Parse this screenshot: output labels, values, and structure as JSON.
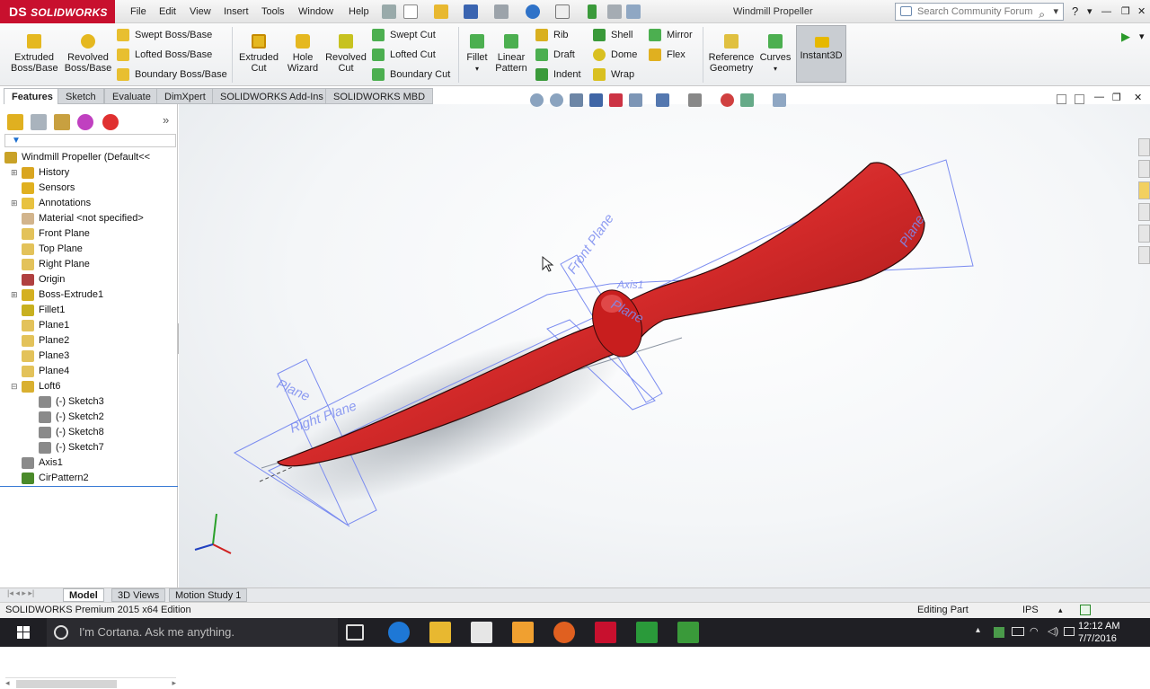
{
  "app": {
    "brand": "SOLIDWORKS",
    "brand_mark": "DS",
    "window_title": "Windmill Propeller"
  },
  "menu": [
    "File",
    "Edit",
    "View",
    "Insert",
    "Tools",
    "Window",
    "Help"
  ],
  "search": {
    "placeholder": "Search Community Forum"
  },
  "ribbon": {
    "extruded_boss": [
      "Extruded",
      "Boss/Base"
    ],
    "revolved_boss": [
      "Revolved",
      "Boss/Base"
    ],
    "swept_boss": "Swept Boss/Base",
    "lofted_boss": "Lofted Boss/Base",
    "boundary_boss": "Boundary Boss/Base",
    "extruded_cut": [
      "Extruded",
      "Cut"
    ],
    "hole_wizard": [
      "Hole",
      "Wizard"
    ],
    "revolved_cut": [
      "Revolved",
      "Cut"
    ],
    "swept_cut": "Swept Cut",
    "lofted_cut": "Lofted Cut",
    "boundary_cut": "Boundary Cut",
    "fillet": "Fillet",
    "linear_pattern": [
      "Linear",
      "Pattern"
    ],
    "rib": "Rib",
    "draft": "Draft",
    "indent": "Indent",
    "shell": "Shell",
    "dome": "Dome",
    "wrap": "Wrap",
    "mirror": "Mirror",
    "flex": "Flex",
    "reference_geometry": [
      "Reference",
      "Geometry"
    ],
    "curves": "Curves",
    "instant3d": "Instant3D"
  },
  "command_tabs": [
    "Features",
    "Sketch",
    "Evaluate",
    "DimXpert",
    "SOLIDWORKS Add-Ins",
    "SOLIDWORKS MBD"
  ],
  "tree": [
    {
      "label": "Windmill Propeller  (Default<<",
      "icon": "part-icon",
      "color": "#c9a227"
    },
    {
      "label": "History",
      "icon": "history-icon",
      "color": "#d9a520"
    },
    {
      "label": "Sensors",
      "icon": "sensors-icon",
      "color": "#e0b020"
    },
    {
      "label": "Annotations",
      "icon": "annotations-icon",
      "color": "#e8c240"
    },
    {
      "label": "Material <not specified>",
      "icon": "material-icon",
      "color": "#d2b48c"
    },
    {
      "label": "Front Plane",
      "icon": "plane-icon",
      "color": "#e3c25a"
    },
    {
      "label": "Top Plane",
      "icon": "plane-icon",
      "color": "#e3c25a"
    },
    {
      "label": "Right Plane",
      "icon": "plane-icon",
      "color": "#e3c25a"
    },
    {
      "label": "Origin",
      "icon": "origin-icon",
      "color": "#b04040"
    },
    {
      "label": "Boss-Extrude1",
      "icon": "extrude-icon",
      "color": "#d4b020"
    },
    {
      "label": "Fillet1",
      "icon": "fillet-icon",
      "color": "#c8b020"
    },
    {
      "label": "Plane1",
      "icon": "plane-icon",
      "color": "#e3c25a"
    },
    {
      "label": "Plane2",
      "icon": "plane-icon",
      "color": "#e3c25a"
    },
    {
      "label": "Plane3",
      "icon": "plane-icon",
      "color": "#e3c25a"
    },
    {
      "label": "Plane4",
      "icon": "plane-icon",
      "color": "#e3c25a"
    },
    {
      "label": "Loft6",
      "icon": "loft-icon",
      "color": "#d9b030"
    },
    {
      "label": "(-) Sketch3",
      "icon": "sketch-icon",
      "color": "#8a8a8a"
    },
    {
      "label": "(-) Sketch2",
      "icon": "sketch-icon",
      "color": "#8a8a8a"
    },
    {
      "label": "(-) Sketch8",
      "icon": "sketch-icon",
      "color": "#8a8a8a"
    },
    {
      "label": "(-) Sketch7",
      "icon": "sketch-icon",
      "color": "#8a8a8a"
    },
    {
      "label": "Axis1",
      "icon": "axis-icon",
      "color": "#8a8a8a"
    },
    {
      "label": "CirPattern2",
      "icon": "pattern-icon",
      "color": "#4a8a2a"
    }
  ],
  "viewport_labels": {
    "axis": "Axis1",
    "front_plane": "Front Plane",
    "right_plane": "Right Plane",
    "plane_near": "Plane",
    "plane_top": "Plane",
    "right_near": "Right Plane",
    "top_plane": "Plane"
  },
  "bottom_tabs": [
    "Model",
    "3D Views",
    "Motion Study 1"
  ],
  "status": {
    "edition": "SOLIDWORKS Premium 2015 x64 Edition",
    "mode": "Editing Part",
    "units": "IPS"
  },
  "taskbar": {
    "cortana_placeholder": "I'm Cortana. Ask me anything.",
    "time": "12:12 AM",
    "date": "7/7/2016"
  },
  "colors": {
    "brand": "#c8102e",
    "propeller": "#d42a2a",
    "plane_outline": "#7b8cf0"
  }
}
